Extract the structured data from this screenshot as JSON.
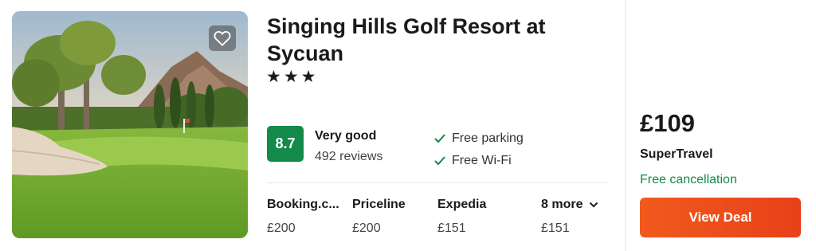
{
  "hotel": {
    "name": "Singing Hills Golf Resort at Sycuan",
    "stars": "★★★",
    "image": "golf-course-photo",
    "favorite_icon": "heart-icon"
  },
  "rating": {
    "score": "8.7",
    "label": "Very good",
    "reviews": "492 reviews",
    "badge_color": "#13894a"
  },
  "amenities": [
    {
      "label": "Free parking",
      "icon": "check-icon"
    },
    {
      "label": "Free Wi-Fi",
      "icon": "check-icon"
    }
  ],
  "providers": [
    {
      "name": "Booking.c...",
      "price": "£200"
    },
    {
      "name": "Priceline",
      "price": "£200"
    },
    {
      "name": "Expedia",
      "price": "£151"
    }
  ],
  "more_providers": {
    "label": "8 more",
    "price": "£151",
    "icon": "chevron-down-icon"
  },
  "deal": {
    "price": "£109",
    "provider": "SuperTravel",
    "cancellation": "Free cancellation",
    "button_label": "View Deal",
    "button_color": "#ef4a1c",
    "cancellation_color": "#13894a"
  }
}
